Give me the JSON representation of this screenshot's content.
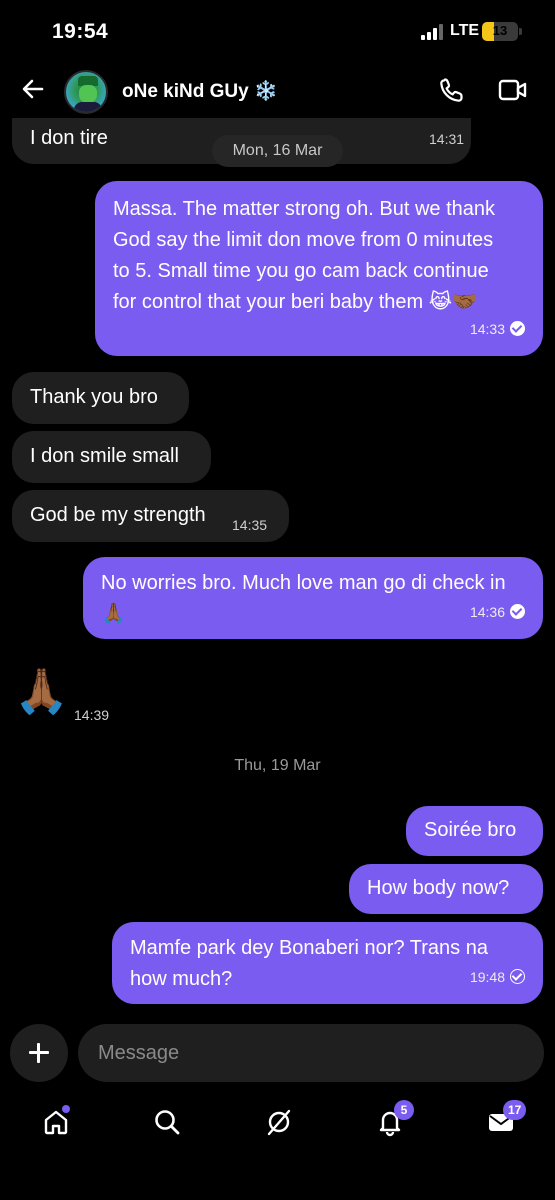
{
  "status_bar": {
    "time": "19:54",
    "network": "LTE",
    "battery": "13"
  },
  "header": {
    "contact_name": "oNe kiNd GUy ❄️"
  },
  "chat": {
    "date_divider_1": "Mon, 16 Mar",
    "date_divider_2": "Thu, 19 Mar",
    "messages": [
      {
        "text": "I don tire",
        "time": "14:31"
      },
      {
        "text": "Massa. The matter strong oh.  But we thank God say the limit don move from 0 minutes to 5. Small time you go cam back continue for control that your beri baby them 😹🤝🏾",
        "time": "14:33"
      },
      {
        "text": "Thank you bro"
      },
      {
        "text": "I don smile small"
      },
      {
        "text": "God be my strength",
        "time": "14:35"
      },
      {
        "text": "No worries bro. Much love man go di check in 🙏🏾",
        "time": "14:36"
      },
      {
        "text": "🙏🏾",
        "time": "14:39"
      },
      {
        "text": "Soirée bro"
      },
      {
        "text": "How body now?"
      },
      {
        "text": "Mamfe park dey Bonaberi nor? Trans na how much?",
        "time": "19:48"
      }
    ]
  },
  "composer": {
    "placeholder": "Message"
  },
  "nav": {
    "notifications_badge": "5",
    "messages_badge": "17"
  },
  "colors": {
    "accent": "#7b5cf0",
    "incoming_bubble": "#1f1f1f",
    "background": "#000000"
  },
  "icons": [
    "back-arrow-icon",
    "phone-icon",
    "video-icon",
    "plus-icon",
    "home-icon",
    "search-icon",
    "grok-icon",
    "bell-icon",
    "mail-icon"
  ]
}
